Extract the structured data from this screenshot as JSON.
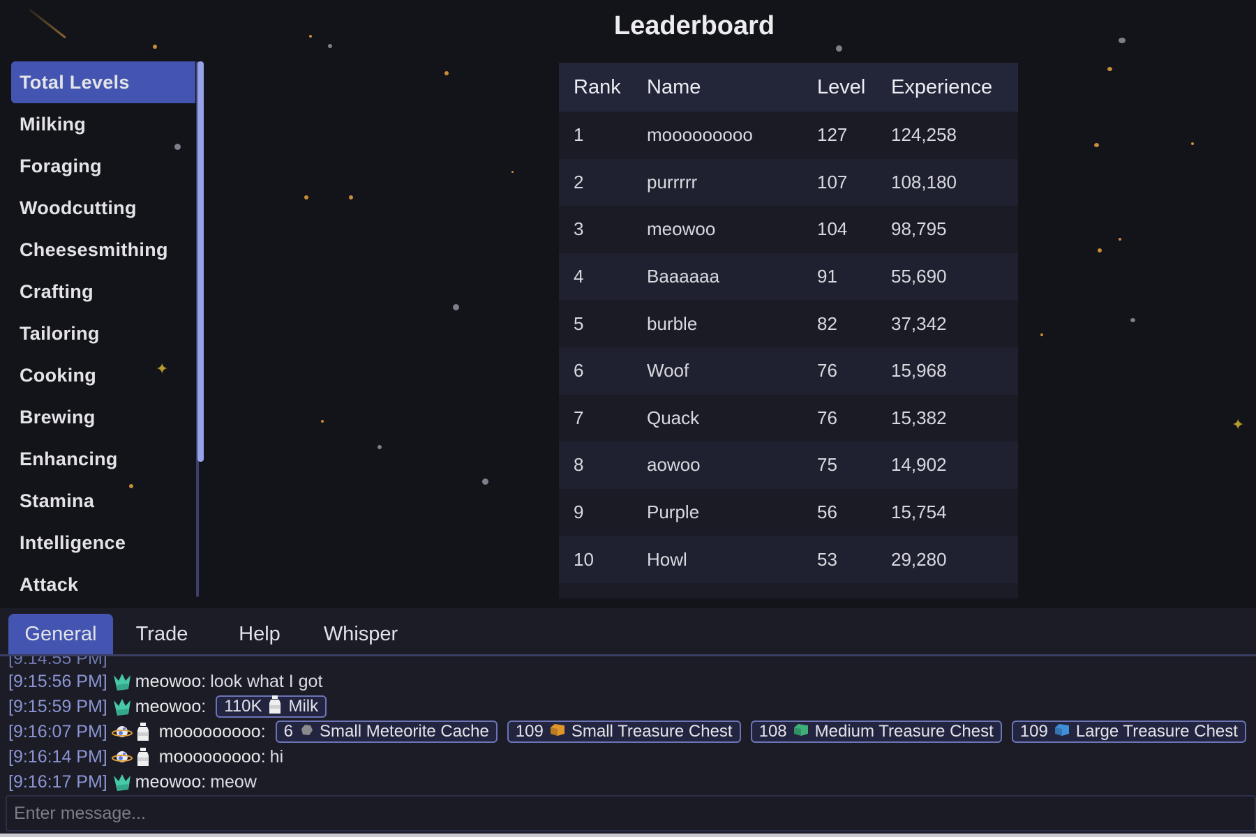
{
  "page": {
    "title": "Leaderboard"
  },
  "sidebar": {
    "active_index": 0,
    "items": [
      {
        "label": "Total Levels"
      },
      {
        "label": "Milking"
      },
      {
        "label": "Foraging"
      },
      {
        "label": "Woodcutting"
      },
      {
        "label": "Cheesesmithing"
      },
      {
        "label": "Crafting"
      },
      {
        "label": "Tailoring"
      },
      {
        "label": "Cooking"
      },
      {
        "label": "Brewing"
      },
      {
        "label": "Enhancing"
      },
      {
        "label": "Stamina"
      },
      {
        "label": "Intelligence"
      },
      {
        "label": "Attack"
      }
    ]
  },
  "leaderboard": {
    "columns": [
      "Rank",
      "Name",
      "Level",
      "Experience"
    ],
    "rows": [
      {
        "rank": "1",
        "name": "mooooooooo",
        "level": "127",
        "experience": "124,258"
      },
      {
        "rank": "2",
        "name": "purrrrr",
        "level": "107",
        "experience": "108,180"
      },
      {
        "rank": "3",
        "name": "meowoo",
        "level": "104",
        "experience": "98,795"
      },
      {
        "rank": "4",
        "name": "Baaaaaa",
        "level": "91",
        "experience": "55,690"
      },
      {
        "rank": "5",
        "name": "burble",
        "level": "82",
        "experience": "37,342"
      },
      {
        "rank": "6",
        "name": "Woof",
        "level": "76",
        "experience": "15,968"
      },
      {
        "rank": "7",
        "name": "Quack",
        "level": "76",
        "experience": "15,382"
      },
      {
        "rank": "8",
        "name": "aowoo",
        "level": "75",
        "experience": "14,902"
      },
      {
        "rank": "9",
        "name": "Purple",
        "level": "56",
        "experience": "15,754"
      },
      {
        "rank": "10",
        "name": "Howl",
        "level": "53",
        "experience": "29,280"
      }
    ]
  },
  "chat": {
    "tabs": [
      {
        "label": "General",
        "active": true
      },
      {
        "label": "Trade",
        "active": false
      },
      {
        "label": "Help",
        "active": false
      },
      {
        "label": "Whisper",
        "active": false
      }
    ],
    "messages": [
      {
        "time": "[9:15:56 PM]",
        "user": "meowoo",
        "user_icons": [
          "crown-icon"
        ],
        "text": "look what I got",
        "items": []
      },
      {
        "time": "[9:15:59 PM]",
        "user": "meowoo",
        "user_icons": [
          "crown-icon"
        ],
        "text": "",
        "items": [
          {
            "count": "110K",
            "icon": "milk-icon",
            "name": "Milk",
            "icon_color": "#e8e8ea"
          }
        ]
      },
      {
        "time": "[9:16:07 PM]",
        "user": "mooooooooo",
        "user_icons": [
          "planet-cow-icon",
          "milk-bottle-icon"
        ],
        "text": "",
        "items": [
          {
            "count": "6",
            "icon": "meteorite-icon",
            "name": "Small Meteorite Cache",
            "icon_color": "#8b8b8f"
          },
          {
            "count": "109",
            "icon": "small-chest-icon",
            "name": "Small Treasure Chest",
            "icon_color": "#e0962a"
          },
          {
            "count": "108",
            "icon": "medium-chest-icon",
            "name": "Medium Treasure Chest",
            "icon_color": "#3fb07a"
          },
          {
            "count": "109",
            "icon": "large-chest-icon",
            "name": "Large Treasure Chest",
            "icon_color": "#3f8fd8"
          }
        ]
      },
      {
        "time": "[9:16:14 PM]",
        "user": "mooooooooo",
        "user_icons": [
          "planet-cow-icon",
          "milk-bottle-icon"
        ],
        "text": "hi",
        "items": []
      },
      {
        "time": "[9:16:17 PM]",
        "user": "meowoo",
        "user_icons": [
          "crown-icon"
        ],
        "text": "meow",
        "items": []
      }
    ],
    "input": {
      "placeholder": "Enter message...",
      "value": ""
    }
  },
  "colors": {
    "accent": "#4355b0",
    "scrollbar": "#98a2e8",
    "timestamp": "#8c95d4",
    "background": "#131419",
    "chip_border": "#6b74b5"
  }
}
